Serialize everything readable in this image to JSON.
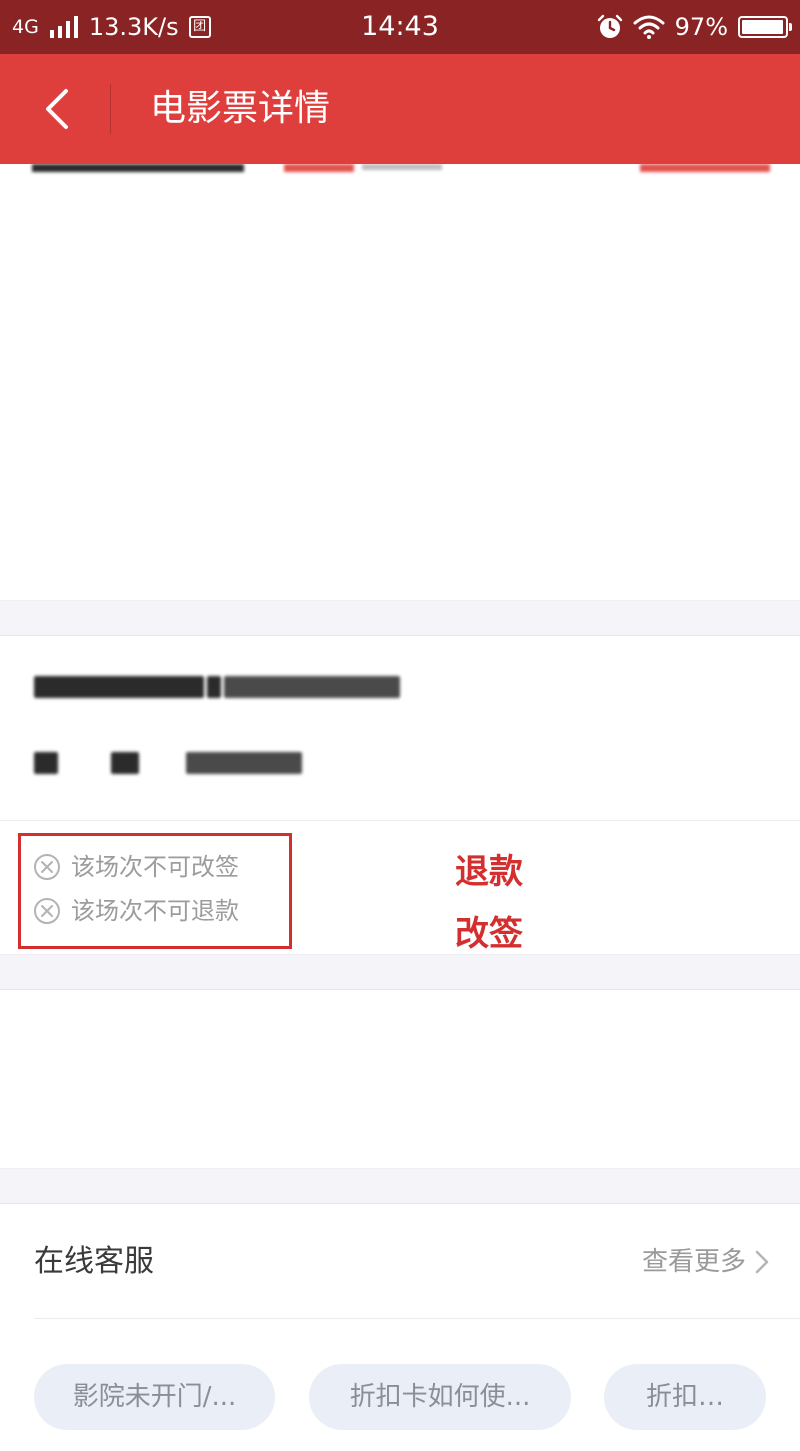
{
  "status_bar": {
    "network": "4G",
    "speed": "13.3K/s",
    "badge": "团",
    "time": "14:43",
    "battery": "97%",
    "battery_level": 0.97
  },
  "nav": {
    "title": "电影票详情"
  },
  "ticket_policy": {
    "rules": [
      "该场次不可改签",
      "该场次不可退款"
    ]
  },
  "annotation": {
    "lines": [
      "退款",
      "改签"
    ]
  },
  "customer_service": {
    "title": "在线客服",
    "more_label": "查看更多",
    "chips": [
      "影院未开门/...",
      "折扣卡如何使...",
      "折扣…"
    ]
  },
  "colors": {
    "status_bar_bg": "#8a2323",
    "nav_bg": "#df3f3c",
    "accent_red": "#d32f2f"
  }
}
